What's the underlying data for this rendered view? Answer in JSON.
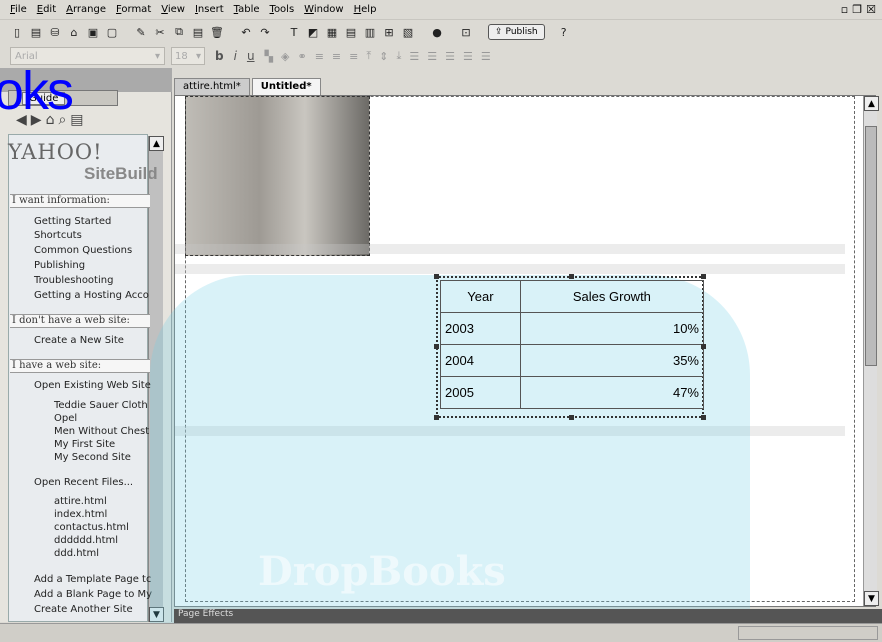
{
  "menu": [
    "File",
    "Edit",
    "Arrange",
    "Format",
    "View",
    "Insert",
    "Table",
    "Tools",
    "Window",
    "Help"
  ],
  "toolbar": {
    "publish_label": "Publish"
  },
  "format": {
    "font_value": "Arial",
    "size_value": "18"
  },
  "left_pane": {
    "tab_label": "Guide",
    "logo_text": "YAHOO!",
    "logo_subtext": "SiteBuild",
    "section_info": "I want information:",
    "info_links": [
      "Getting Started",
      "Shortcuts",
      "Common Questions",
      "Publishing",
      "Troubleshooting",
      "Getting a Hosting Acco"
    ],
    "section_noweb": "I don't have a web site:",
    "noweb_links": [
      "Create a New Site"
    ],
    "section_haveweb": "I have a web site:",
    "open_existing": "Open Existing Web Site",
    "sites": [
      "Teddie Sauer Cloth",
      "Opel",
      "Men Without Chest",
      "My First Site",
      "My Second Site"
    ],
    "open_recent": "Open Recent Files...",
    "recent_files": [
      "attire.html",
      "index.html",
      "contactus.html",
      "dddddd.html",
      "ddd.html"
    ],
    "bottom_links": [
      "Add a Template Page tc",
      "Add a Blank Page to My",
      "Create Another Site"
    ]
  },
  "editor": {
    "tabs": [
      "attire.html*",
      "Untitled*"
    ],
    "table": {
      "headers": [
        "Year",
        "Sales Growth"
      ],
      "rows": [
        [
          "2003",
          "10%"
        ],
        [
          "2004",
          "35%"
        ],
        [
          "2005",
          "47%"
        ]
      ]
    }
  },
  "page_effects_label": "Page Effects",
  "watermark": {
    "brand": "oks",
    "text": "DropBooks"
  }
}
